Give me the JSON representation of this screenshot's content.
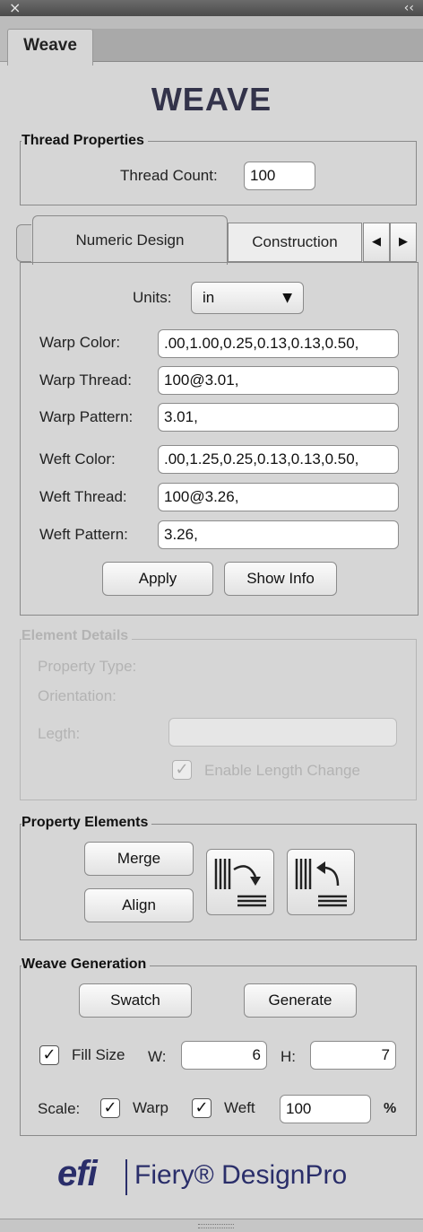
{
  "panel": {
    "close_glyph": "×",
    "collapse_glyph": "‹‹",
    "tab_label": "Weave"
  },
  "app_title": "WEAVE",
  "thread_properties": {
    "group_label": "Thread Properties",
    "thread_count_label": "Thread Count:",
    "thread_count_value": "100"
  },
  "design_tabs": {
    "tabs": [
      "Numeric Design",
      "Construction"
    ],
    "active": "Numeric Design"
  },
  "numeric_design": {
    "units_label": "Units:",
    "units_value": "in",
    "warp_color_label": "Warp Color:",
    "warp_color_value": ".00,1.00,0.25,0.13,0.13,0.50,",
    "warp_thread_label": "Warp Thread:",
    "warp_thread_value": "100@3.01,",
    "warp_pattern_label": "Warp Pattern:",
    "warp_pattern_value": "3.01,",
    "weft_color_label": "Weft Color:",
    "weft_color_value": ".00,1.25,0.25,0.13,0.13,0.50,",
    "weft_thread_label": "Weft Thread:",
    "weft_thread_value": "100@3.26,",
    "weft_pattern_label": "Weft Pattern:",
    "weft_pattern_value": "3.26,",
    "apply_label": "Apply",
    "show_info_label": "Show Info"
  },
  "element_details": {
    "group_label": "Element Details",
    "property_type_label": "Property Type:",
    "orientation_label": "Orientation:",
    "length_label": "Legth:",
    "enable_length_label": "Enable Length Change"
  },
  "property_elements": {
    "group_label": "Property Elements",
    "merge_label": "Merge",
    "align_label": "Align"
  },
  "weave_generation": {
    "group_label": "Weave Generation",
    "swatch_label": "Swatch",
    "generate_label": "Generate",
    "fill_size_label": "Fill Size",
    "w_label": "W:",
    "w_value": "6",
    "h_label": "H:",
    "h_value": "7",
    "scale_label": "Scale:",
    "warp_label": "Warp",
    "weft_label": "Weft",
    "scale_value": "100",
    "percent": "%"
  },
  "footer": {
    "logo_text": "efi",
    "product_name": "Fiery® DesignPro"
  },
  "colors": {
    "title": "#33334a",
    "background": "#d6d6d6",
    "disabled": "#b3b3b3"
  }
}
